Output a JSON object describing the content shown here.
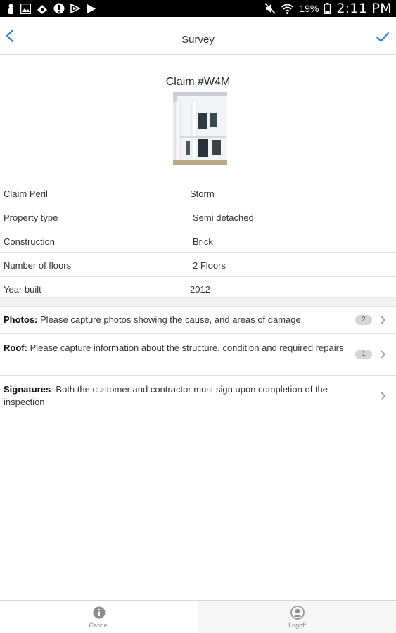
{
  "status_bar": {
    "battery_percent": "19%",
    "time": "2:11 PM",
    "left_icons": [
      "person-icon",
      "image-icon",
      "usb-icon",
      "alert-icon",
      "download-icon",
      "play-store-icon"
    ],
    "right_icons": [
      "mute-icon",
      "wifi-icon",
      "battery-icon"
    ]
  },
  "nav": {
    "title": "Survey",
    "back_icon": "chevron-left-icon",
    "confirm_icon": "checkmark-icon",
    "accent_color": "#2a7fd4"
  },
  "claim": {
    "title": "Claim #W4M"
  },
  "details": [
    {
      "label": "Claim Peril",
      "value": "Storm"
    },
    {
      "label": "Property type",
      "value": "Semi detached"
    },
    {
      "label": "Construction",
      "value": "Brick"
    },
    {
      "label": "Number of floors",
      "value": "2 Floors"
    },
    {
      "label": "Year built",
      "value": "2012"
    }
  ],
  "tasks": [
    {
      "title": "Photos:",
      "text": "Please capture photos showing the cause, and areas of damage.",
      "badge": "2"
    },
    {
      "title": "Roof:",
      "text": "Please capture information about the structure, condition and required repairs",
      "badge": "1"
    },
    {
      "title": "Signatures",
      "text": ": Both the customer and contractor must sign upon completion of the inspection",
      "badge": ""
    }
  ],
  "tab_bar": {
    "cancel_label": "Cancel",
    "logoff_label": "Logoff",
    "cancel_icon": "info-icon",
    "logoff_icon": "user-icon"
  }
}
